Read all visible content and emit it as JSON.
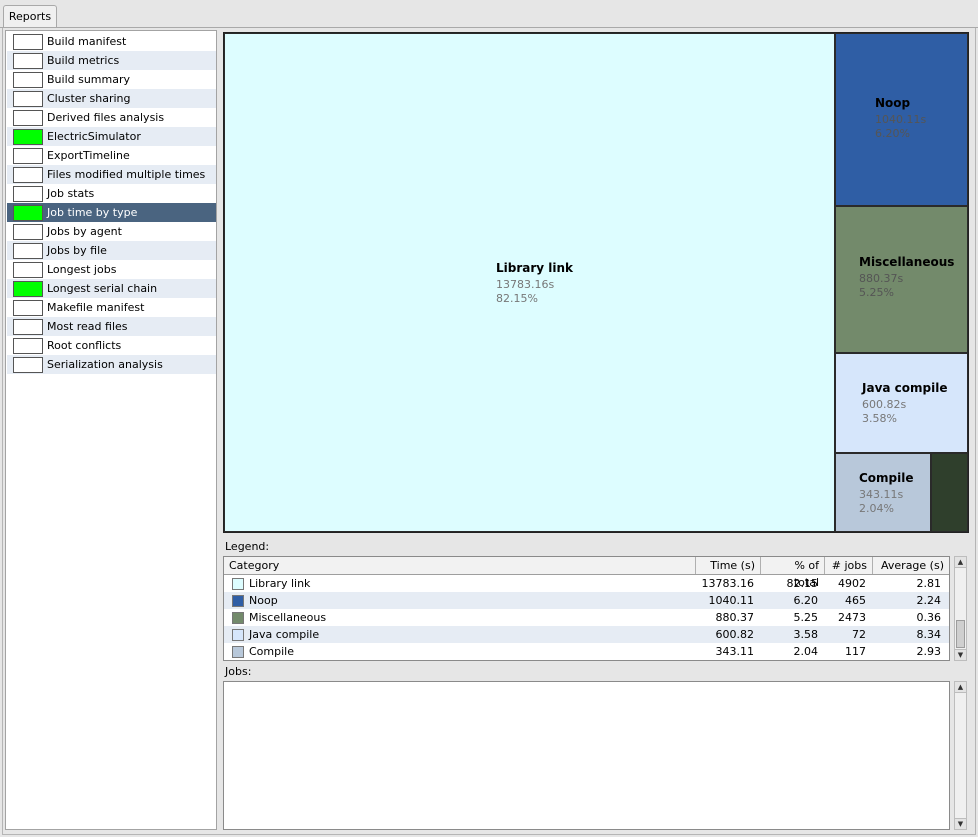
{
  "tabs": {
    "reports_label": "Reports"
  },
  "reports": [
    {
      "label": "Build manifest",
      "checked": false
    },
    {
      "label": "Build metrics",
      "checked": false
    },
    {
      "label": "Build summary",
      "checked": false
    },
    {
      "label": "Cluster sharing",
      "checked": false
    },
    {
      "label": "Derived files analysis",
      "checked": false
    },
    {
      "label": "ElectricSimulator",
      "checked": true
    },
    {
      "label": "ExportTimeline",
      "checked": false
    },
    {
      "label": "Files modified multiple times",
      "checked": false
    },
    {
      "label": "Job stats",
      "checked": false
    },
    {
      "label": "Job time by type",
      "checked": true,
      "selected": true
    },
    {
      "label": "Jobs by agent",
      "checked": false
    },
    {
      "label": "Jobs by file",
      "checked": false
    },
    {
      "label": "Longest jobs",
      "checked": false
    },
    {
      "label": "Longest serial chain",
      "checked": true
    },
    {
      "label": "Makefile manifest",
      "checked": false
    },
    {
      "label": "Most read files",
      "checked": false
    },
    {
      "label": "Root conflicts",
      "checked": false
    },
    {
      "label": "Serialization analysis",
      "checked": false
    }
  ],
  "treemap": [
    {
      "name": "Library link",
      "time": "13783.16s",
      "pct": "82.15%",
      "color": "#ddfdff"
    },
    {
      "name": "Noop",
      "time": "1040.11s",
      "pct": "6.20%",
      "color": "#2f5ea5"
    },
    {
      "name": "Miscellaneous",
      "time": "880.37s",
      "pct": "5.25%",
      "color": "#738a6b"
    },
    {
      "name": "Java compile",
      "time": "600.82s",
      "pct": "3.58%",
      "color": "#d6e6fb"
    },
    {
      "name": "Compile",
      "time": "343.11s",
      "pct": "2.04%",
      "color": "#b8c8da"
    }
  ],
  "treemap_extra_color": "#2f3f2c",
  "legend": {
    "label": "Legend:",
    "columns": [
      "Category",
      "Time (s)",
      "% of total",
      "# jobs",
      "Average (s)"
    ],
    "rows": [
      {
        "category": "Library link",
        "time": "13783.16",
        "pct": "82.15",
        "jobs": "4902",
        "avg": "2.81",
        "color": "#ddfdff"
      },
      {
        "category": "Noop",
        "time": "1040.11",
        "pct": "6.20",
        "jobs": "465",
        "avg": "2.24",
        "color": "#2f5ea5"
      },
      {
        "category": "Miscellaneous",
        "time": "880.37",
        "pct": "5.25",
        "jobs": "2473",
        "avg": "0.36",
        "color": "#738a6b"
      },
      {
        "category": "Java compile",
        "time": "600.82",
        "pct": "3.58",
        "jobs": "72",
        "avg": "8.34",
        "color": "#d6e6fb"
      },
      {
        "category": "Compile",
        "time": "343.11",
        "pct": "2.04",
        "jobs": "117",
        "avg": "2.93",
        "color": "#b8c8da"
      }
    ]
  },
  "jobs": {
    "label": "Jobs:"
  }
}
